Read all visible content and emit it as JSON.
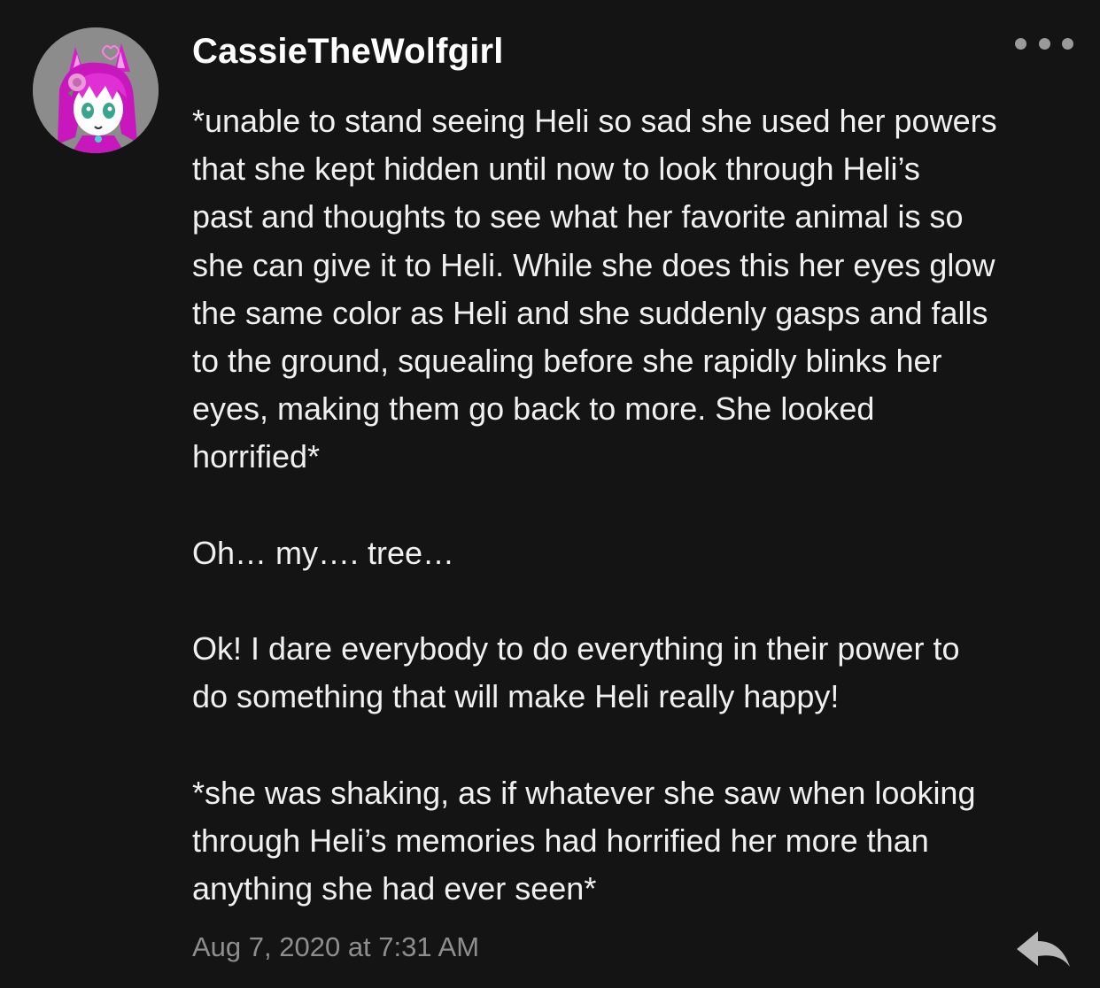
{
  "comment": {
    "username": "CassieTheWolfgirl",
    "avatar_icon": "wolfgirl-avatar-icon",
    "more_icon": "more-options-icon",
    "paragraphs": [
      "*unable to stand seeing Heli so sad she used her powers\nthat she kept hidden until now to look through Heli’s\npast and thoughts to see what her favorite animal is so\nshe can give it to Heli. While she does this her eyes glow\nthe same color as Heli and she suddenly gasps and falls\nto the ground, squealing before she rapidly blinks her\neyes, making them go back to more. She looked\nhorrified*",
      "Oh… my…. tree…",
      "Ok! I dare everybody to do everything in their power to\ndo something that will make Heli really happy!",
      "*she was shaking, as if whatever she saw when looking\nthrough Heli’s memories had horrified her more than\nanything she had ever seen*"
    ],
    "timestamp": "Aug 7, 2020 at 7:31 AM",
    "reply_icon": "reply-arrow-icon"
  },
  "colors": {
    "background": "#141414",
    "text": "#f0f0f0",
    "muted": "#8e8e8e",
    "avatar_hair": "#d61fc8"
  }
}
